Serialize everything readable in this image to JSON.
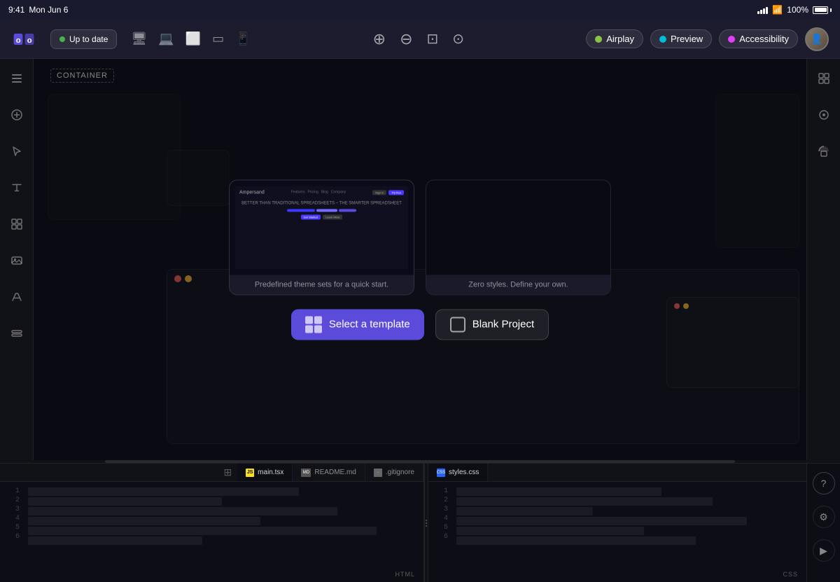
{
  "status_bar": {
    "time": "9:41",
    "day": "Mon Jun 6",
    "battery_pct": "100%"
  },
  "toolbar": {
    "update_label": "Up to date",
    "airplay_label": "Airplay",
    "preview_label": "Preview",
    "accessibility_label": "Accessibility"
  },
  "canvas": {
    "container_label": "CONTAINER"
  },
  "template_modal": {
    "predefined_label": "Predefined theme sets for a quick start.",
    "zero_styles_label": "Zero styles. Define your own.",
    "select_template_label": "Select a template",
    "blank_project_label": "Blank Project"
  },
  "bottom_panel": {
    "left_tabs": [
      {
        "type": "js",
        "label": "main.tsx"
      },
      {
        "type": "md",
        "label": "README.md"
      },
      {
        "type": "dot",
        "label": ".gitignore"
      }
    ],
    "left_file_type": "HTML",
    "right_tabs": [
      {
        "type": "css",
        "label": "styles.css"
      }
    ],
    "right_file_type": "CSS"
  },
  "icons": {
    "layers": "⊟",
    "add": "✦",
    "cursor": "↖",
    "text": "T",
    "components": "❖",
    "image": "⊞",
    "font": "A",
    "sticker": "⊕",
    "panel_icon_1": "⊞",
    "panel_icon_2": "◈",
    "panel_icon_3": "◉",
    "zoom_in": "⊕",
    "zoom_out": "⊖",
    "fit": "⊡",
    "screenshot": "⊙",
    "right_panel_1": "⊞",
    "right_panel_2": "◈",
    "help": "?",
    "settings": "⚙",
    "play": "▶"
  }
}
